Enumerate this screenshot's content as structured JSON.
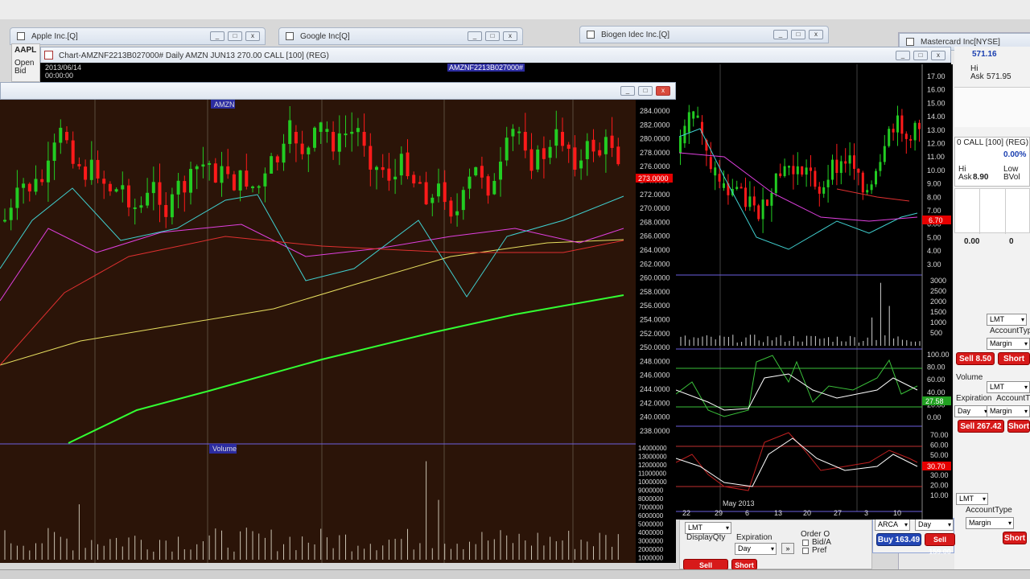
{
  "windows": {
    "apple": {
      "title": "Apple Inc.[Q]"
    },
    "google": {
      "title": "Google Inc[Q]"
    },
    "biogen": {
      "title": "Biogen Idec Inc.[Q]"
    },
    "mastercard": {
      "title": "Mastercard Inc[NYSE]"
    }
  },
  "apple_panel": {
    "symbol": "AAPL",
    "open_label": "Open",
    "bid_label": "Bid"
  },
  "main_chart": {
    "title": "Chart-AMZNF2213B027000# Daily AMZN JUN13 270.00 CALL [100] (REG)",
    "date": "2013/06/14",
    "time": "00:00:00",
    "symbol_tag": "AMZNF2213B027000#",
    "price_label": "AMZN",
    "volume_label": "Volume",
    "price_axis": [
      "284.0000",
      "282.0000",
      "280.0000",
      "278.0000",
      "276.0000",
      "274.0000",
      "272.0000",
      "270.0000",
      "268.0000",
      "266.0000",
      "264.0000",
      "262.0000",
      "260.0000",
      "258.0000",
      "256.0000",
      "254.0000",
      "252.0000",
      "250.0000",
      "248.0000",
      "246.0000",
      "244.0000",
      "242.0000",
      "240.0000",
      "238.0000"
    ],
    "last_price": "273.0000",
    "volume_axis": [
      "14000000",
      "13000000",
      "12000000",
      "11000000",
      "10000000",
      "9000000",
      "8000000",
      "7000000",
      "6000000",
      "5000000",
      "4000000",
      "3000000",
      "2000000",
      "1000000"
    ]
  },
  "option_chart": {
    "price_axis": [
      "17.00",
      "16.00",
      "15.00",
      "14.00",
      "13.00",
      "12.00",
      "11.00",
      "10.00",
      "9.00",
      "8.00",
      "7.00",
      "6.00",
      "5.00",
      "4.00",
      "3.00"
    ],
    "last_price": "6.70",
    "volume_axis": [
      "3000",
      "2500",
      "2000",
      "1500",
      "1000",
      "500"
    ],
    "osc1_axis": [
      "100.00",
      "80.00",
      "60.00",
      "40.00",
      "20.00",
      "0.00"
    ],
    "osc1_value": "27.58",
    "osc2_axis": [
      "70.00",
      "60.00",
      "50.00",
      "40.00",
      "30.00",
      "20.00",
      "10.00"
    ],
    "osc2_value": "30.70",
    "x_labels": [
      "22",
      "29",
      "6",
      "13",
      "20",
      "27",
      "3",
      "10"
    ],
    "month_label": "May 2013"
  },
  "mastercard_panel": {
    "last": "571.16",
    "hi_label": "Hi",
    "ask_label": "Ask",
    "ask_value": "571.95",
    "option_title": "0 CALL [100] (REG)",
    "change": "0.00%",
    "hi2_label": "Hi",
    "low_label": "Low",
    "ask2_label": "Ask",
    "ask2_value": "8.90",
    "bvol_label": "BVol",
    "pos_value": "0.00",
    "pos_count": "0",
    "order_type": "LMT",
    "account_type_label": "AccountType",
    "account_value": "Margin",
    "sell_btn": "Sell 8.50",
    "short_btn": "Short",
    "volume_label": "Volume",
    "order_type2": "LMT",
    "expiration_label": "Expiration",
    "account_type_label2": "AccountTy",
    "expiry_value": "Day",
    "account_value2": "Margin",
    "sell_btn2": "Sell 267.42",
    "short_btn2": "Short",
    "order_type3": "LMT",
    "account_type_label3": "AccountType",
    "account_value3": "Margin",
    "buy_btn": "Buy 163.49",
    "sell_btn3": "Sell 159.00",
    "short_btn3": "Short",
    "arca": "ARCA",
    "day3": "Day"
  },
  "bottom_panel": {
    "order_type": "LMT",
    "display_qty_label": "DisplayQty",
    "expiration_label": "Expiration",
    "expiry_value": "Day",
    "order_label": "Order O",
    "bid_label": "Bid/A",
    "pref_label": "Pref",
    "sell_btn": "Sell",
    "short_btn": "Short"
  }
}
